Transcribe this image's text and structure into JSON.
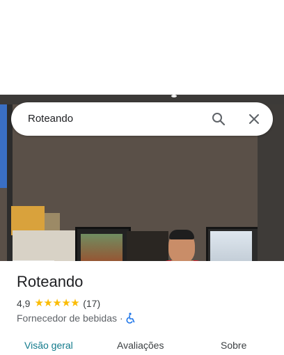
{
  "search": {
    "value": "Roteando",
    "search_icon": "search-icon",
    "close_icon": "close-icon"
  },
  "place": {
    "name": "Roteando",
    "rating": "4,9",
    "stars": 5,
    "reviews_count": "(17)",
    "category": "Fornecedor de bebidas",
    "separator": "·",
    "accessibility_icon": "wheelchair-accessible-icon"
  },
  "tabs": [
    {
      "label": "Visão geral",
      "active": true
    },
    {
      "label": "Avaliações",
      "active": false
    },
    {
      "label": "Sobre",
      "active": false
    }
  ],
  "colors": {
    "star": "#fbbc04",
    "active_tab": "#117a8b",
    "accessibility": "#1a73e8"
  }
}
